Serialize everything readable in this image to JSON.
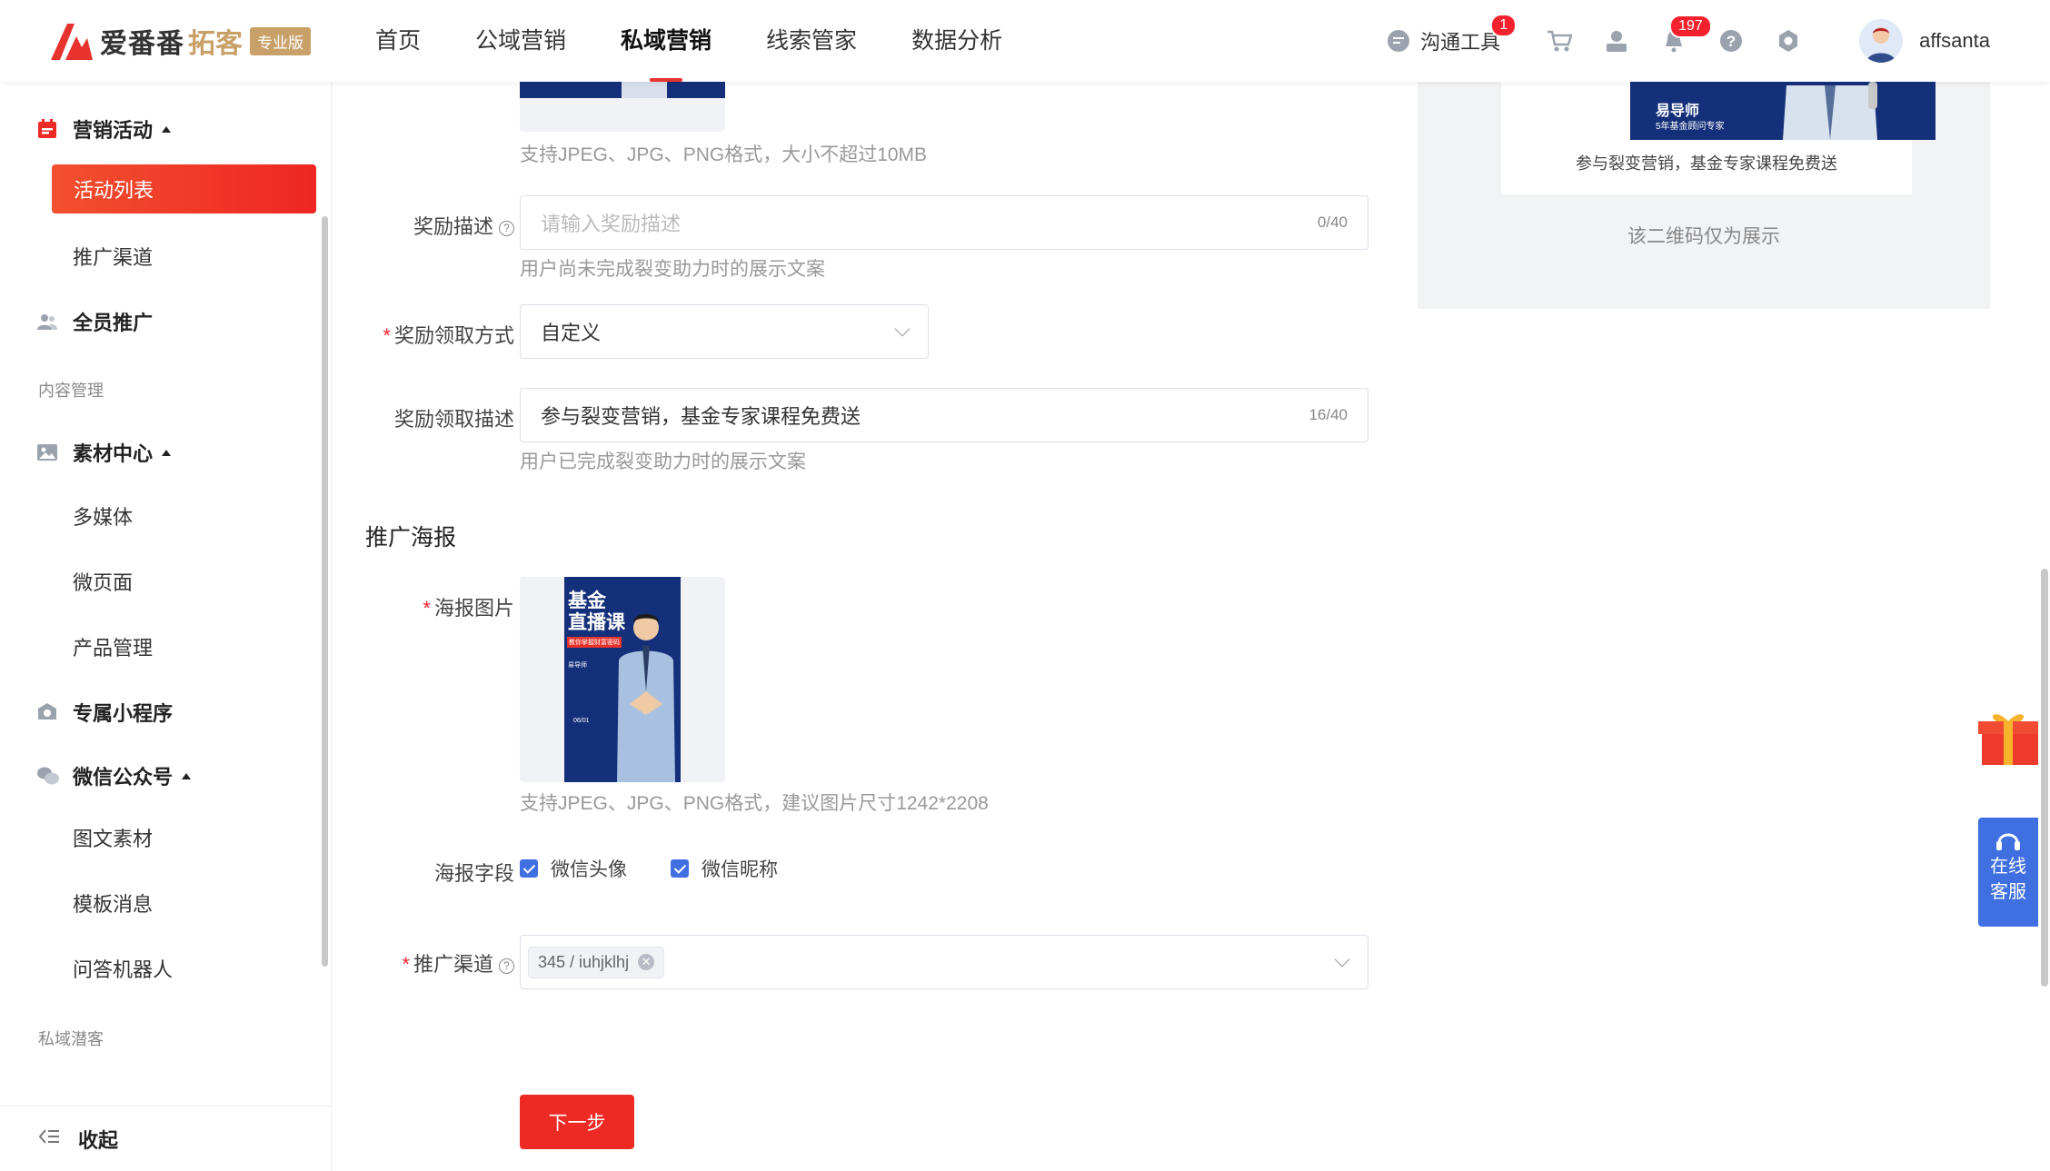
{
  "header": {
    "brand_name": "爱番番",
    "brand_name2": "拓客",
    "brand_badge": "专业版",
    "nav": [
      {
        "label": "首页"
      },
      {
        "label": "公域营销"
      },
      {
        "label": "私域营销",
        "active": true
      },
      {
        "label": "线索管家"
      },
      {
        "label": "数据分析"
      }
    ],
    "comm_tool_label": "沟通工具",
    "comm_tool_badge": "1",
    "notification_badge": "197",
    "username": "affsanta",
    "accent_color": "#e8322d"
  },
  "sidebar": {
    "marketing_activity": "营销活动",
    "activity_list": "活动列表",
    "promotion_channel": "推广渠道",
    "all_staff_promotion": "全员推广",
    "group_content": "内容管理",
    "material_center": "素材中心",
    "multimedia": "多媒体",
    "micro_page": "微页面",
    "product_management": "产品管理",
    "mini_program": "专属小程序",
    "wechat_official": "微信公众号",
    "article_material": "图文素材",
    "template_message": "模板消息",
    "qa_robot": "问答机器人",
    "group_private": "私域潜客",
    "collapse": "收起"
  },
  "form": {
    "format_hint_1": "支持JPEG、JPG、PNG格式，大小不超过10MB",
    "reward_desc_label": "奖励描述",
    "reward_desc_placeholder": "请输入奖励描述",
    "reward_desc_count": "0/40",
    "reward_desc_hint": "用户尚未完成裂变助力时的展示文案",
    "reward_claim_method_label": "奖励领取方式",
    "reward_claim_method_value": "自定义",
    "reward_claim_desc_label": "奖励领取描述",
    "reward_claim_desc_value": "参与裂变营销，基金专家课程免费送",
    "reward_claim_desc_count": "16/40",
    "reward_claim_desc_hint": "用户已完成裂变助力时的展示文案",
    "poster_section_title": "推广海报",
    "poster_image_label": "海报图片",
    "poster_format_hint": "支持JPEG、JPG、PNG格式，建议图片尺寸1242*2208",
    "poster_fields_label": "海报字段",
    "poster_field_avatar": "微信头像",
    "poster_field_nickname": "微信昵称",
    "promo_channel_label": "推广渠道",
    "promo_channel_tag": "345 / iuhjklhj",
    "next_button": "下一步"
  },
  "poster": {
    "title_line1": "基金",
    "title_line2": "直播课",
    "subtitle": "教你掌握财富密码",
    "teacher": "易导师",
    "date": "06/01"
  },
  "preview": {
    "teacher": "易导师",
    "teacher_desc": "5年基金顾问专家",
    "caption": "参与裂变营销，基金专家课程免费送",
    "qr_note": "该二维码仅为展示"
  },
  "float": {
    "customer_service_line1": "在线",
    "customer_service_line2": "客服"
  }
}
